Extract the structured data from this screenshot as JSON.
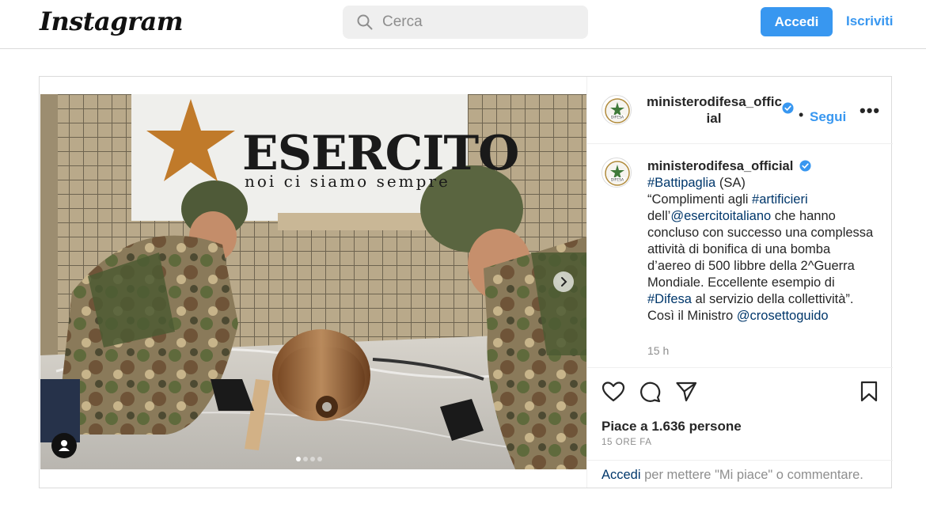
{
  "nav": {
    "logo": "Instagram",
    "search_placeholder": "Cerca",
    "login_label": "Accedi",
    "signup_label": "Iscriviti"
  },
  "banner": {
    "title": "ESERCITO",
    "subtitle": "noi ci siamo sempre"
  },
  "post": {
    "username_line1": "ministerodifesa_offic",
    "username_line2": "ial",
    "follow_label": "Segui",
    "more_label": "•••",
    "caption": {
      "username": "ministerodifesa_official",
      "part1_tag": "#Battipaglia",
      "part1_text": " (SA)",
      "part2_text": "“Complimenti agli ",
      "part2_tag": "#artificieri",
      "part3_text": "dell’",
      "part3_mention": "@esercitoitaliano",
      "part3_rest": " che hanno concluso con successo una complessa attività di bonifica di una bomba d’aereo di 500 libbre della 2^Guerra Mondiale. Eccellente esempio di ",
      "part4_tag": "#Difesa",
      "part4_rest": " al servizio della collettività”. Così il Ministro ",
      "part5_mention": "@crosettoguido",
      "time": "15 h"
    },
    "likes": "Piace a 1.636 persone",
    "time_ago": "15 ORE FA",
    "footer_link": "Accedi",
    "footer_text": " per mettere \"Mi piace\" o commentare.",
    "carousel": {
      "total": 4,
      "active": 1
    }
  },
  "colors": {
    "accent": "#3897f0",
    "link": "#00376b",
    "muted": "#8e8e8e",
    "border": "#dbdbdb"
  },
  "icons": [
    "search-icon",
    "verified-icon",
    "more-icon",
    "heart-icon",
    "comment-icon",
    "share-icon",
    "bookmark-icon",
    "chevron-right-icon",
    "user-tag-icon"
  ]
}
